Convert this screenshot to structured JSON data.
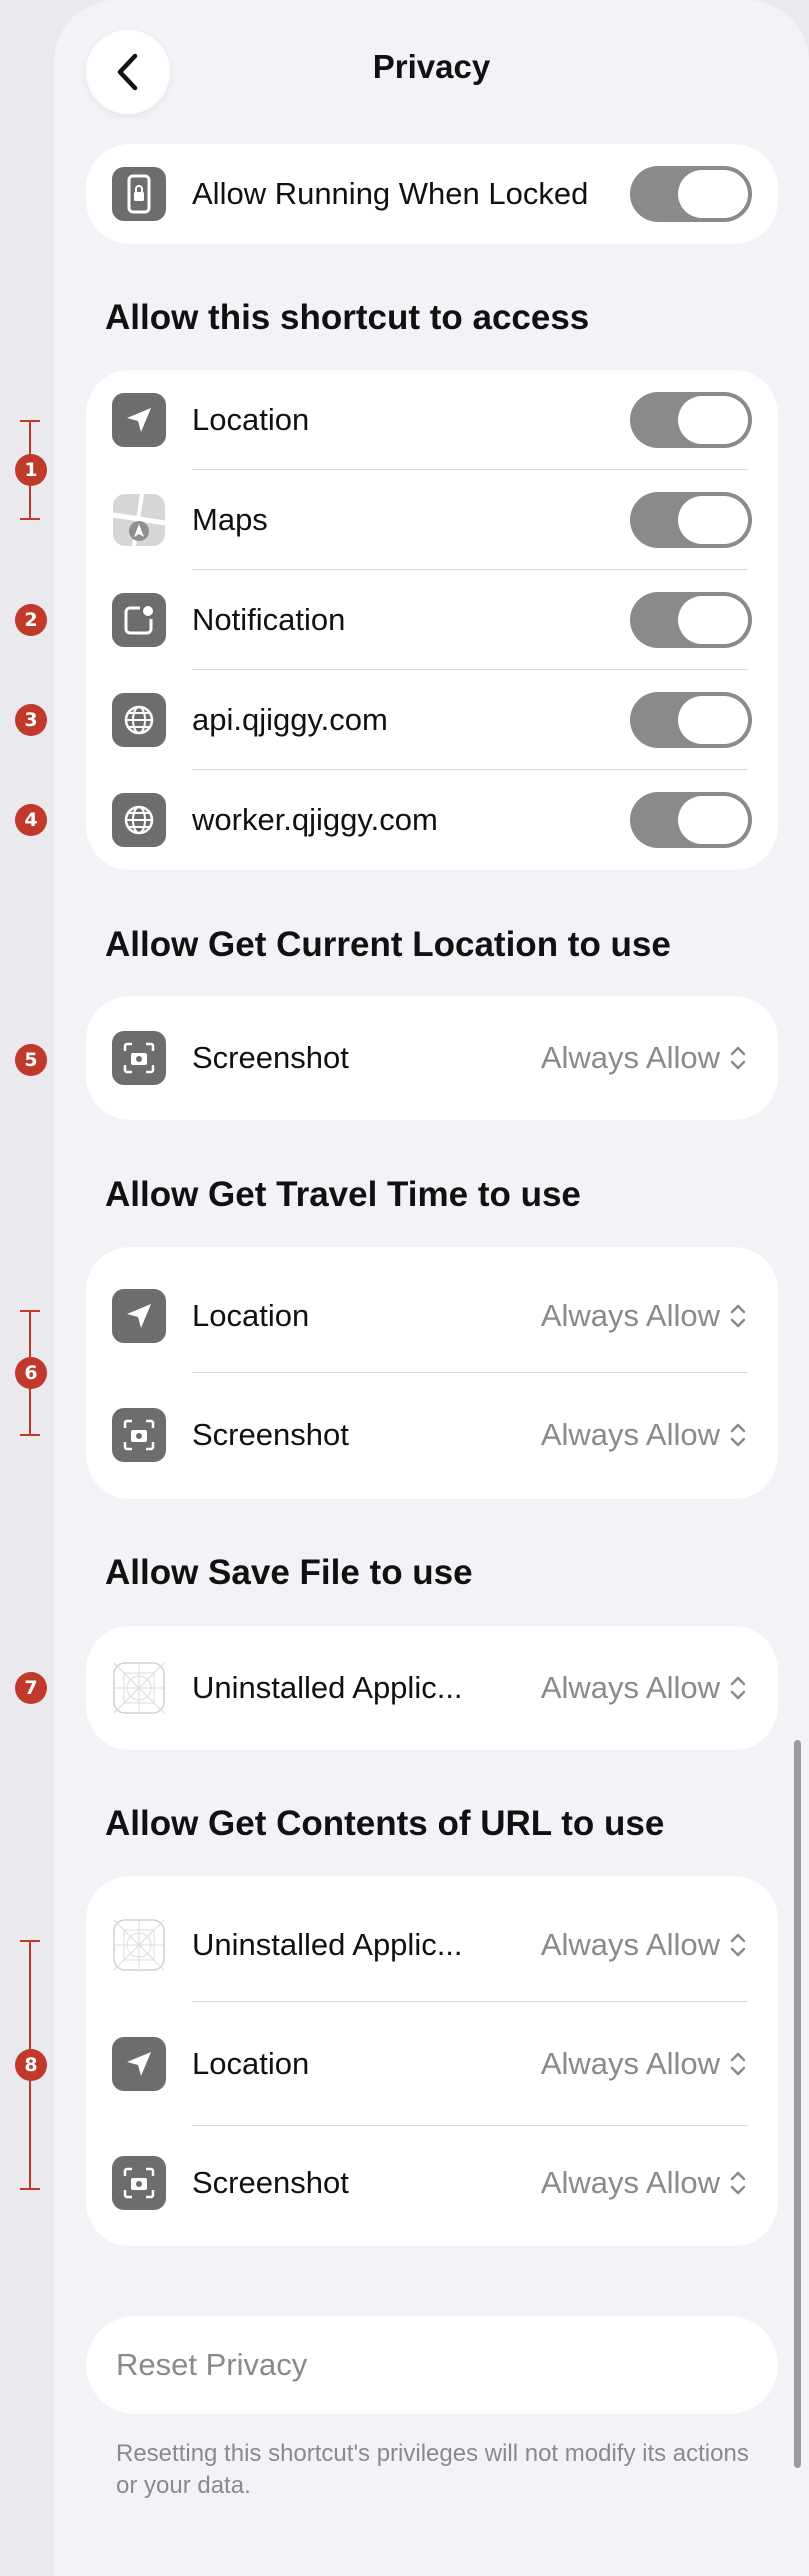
{
  "nav": {
    "title": "Privacy"
  },
  "lock_row": {
    "label": "Allow Running When Locked"
  },
  "sections": {
    "access": {
      "heading": "Allow this shortcut to access",
      "items": [
        {
          "label": "Location",
          "icon": "location-arrow-icon"
        },
        {
          "label": "Maps",
          "icon": "maps-app-icon"
        },
        {
          "label": "Notification",
          "icon": "notification-icon"
        },
        {
          "label": "api.qjiggy.com",
          "icon": "globe-icon"
        },
        {
          "label": "worker.qjiggy.com",
          "icon": "globe-icon"
        }
      ]
    },
    "current_location": {
      "heading": "Allow Get Current Location to use",
      "items": [
        {
          "label": "Screenshot",
          "value": "Always Allow",
          "icon": "screenshot-icon"
        }
      ]
    },
    "travel_time": {
      "heading": "Allow Get Travel Time to use",
      "items": [
        {
          "label": "Location",
          "value": "Always Allow",
          "icon": "location-arrow-icon"
        },
        {
          "label": "Screenshot",
          "value": "Always Allow",
          "icon": "screenshot-icon"
        }
      ]
    },
    "save_file": {
      "heading": "Allow Save File to use",
      "items": [
        {
          "label": "Uninstalled Applic...",
          "value": "Always Allow",
          "icon": "placeholder-app-icon"
        }
      ]
    },
    "contents_url": {
      "heading": "Allow Get Contents of URL to use",
      "items": [
        {
          "label": "Uninstalled Applic...",
          "value": "Always Allow",
          "icon": "placeholder-app-icon"
        },
        {
          "label": "Location",
          "value": "Always Allow",
          "icon": "location-arrow-icon"
        },
        {
          "label": "Screenshot",
          "value": "Always Allow",
          "icon": "screenshot-icon"
        }
      ]
    }
  },
  "reset": {
    "label": "Reset Privacy",
    "footnote": "Resetting this shortcut's privileges will not modify its actions or your data."
  },
  "markers": [
    "1",
    "2",
    "3",
    "4",
    "5",
    "6",
    "7",
    "8"
  ],
  "colors": {
    "marker": "#c0392b",
    "toggle_track": "#8a8a8a",
    "secondary_text": "#8a8a8e"
  }
}
